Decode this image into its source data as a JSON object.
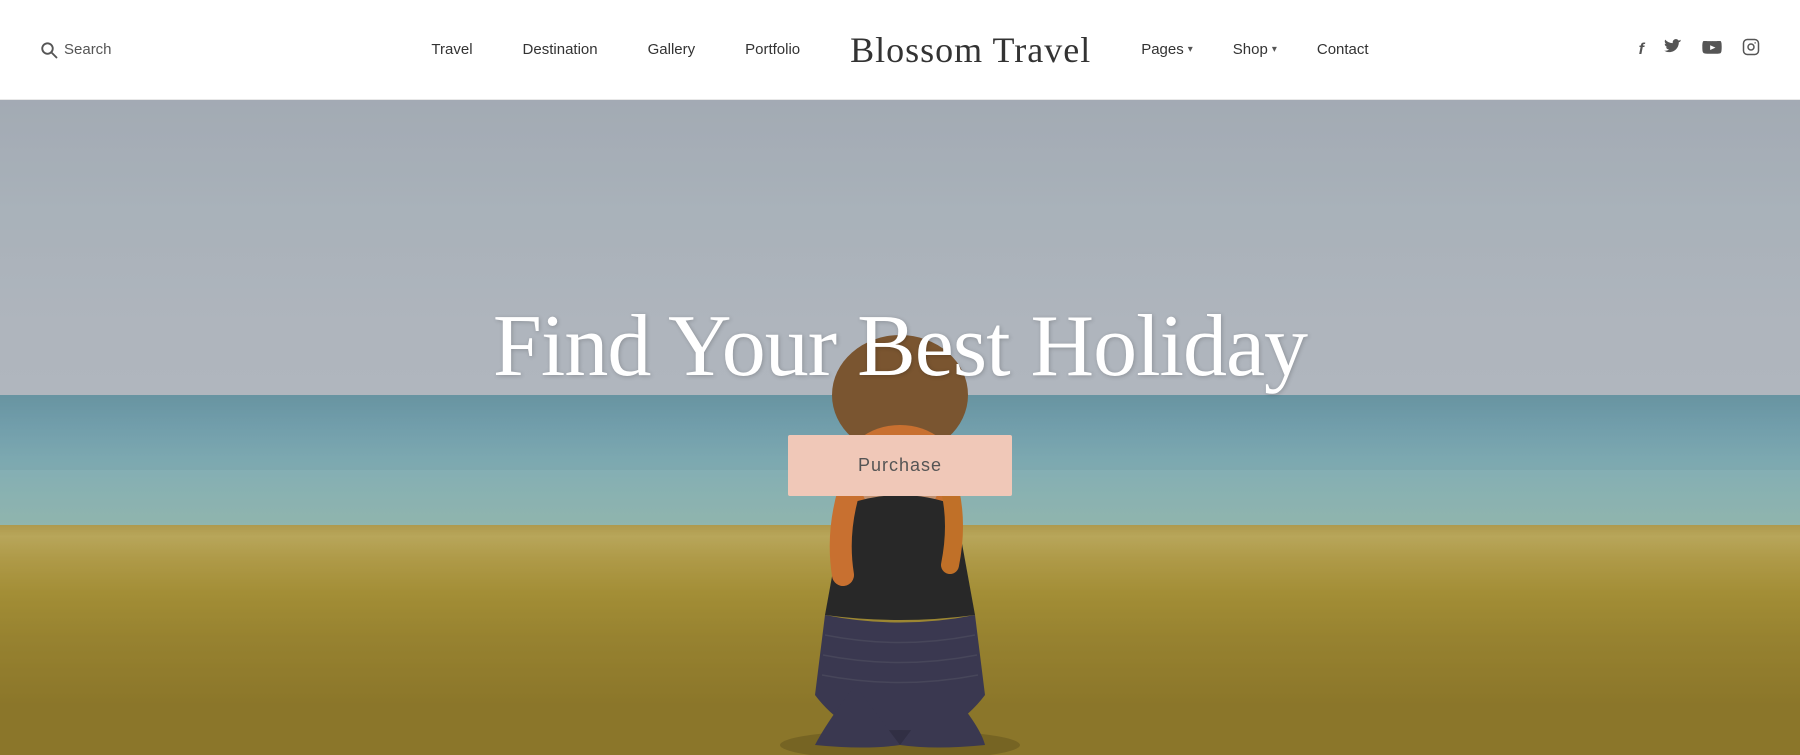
{
  "header": {
    "search_label": "Search",
    "logo": "Blossom Travel",
    "nav_left": [
      {
        "label": "Travel",
        "has_dropdown": false
      },
      {
        "label": "Destination",
        "has_dropdown": false
      },
      {
        "label": "Gallery",
        "has_dropdown": false
      },
      {
        "label": "Portfolio",
        "has_dropdown": false
      }
    ],
    "nav_right": [
      {
        "label": "Pages",
        "has_dropdown": true
      },
      {
        "label": "Shop",
        "has_dropdown": true
      },
      {
        "label": "Contact",
        "has_dropdown": false
      }
    ],
    "social_icons": [
      {
        "name": "facebook-icon",
        "symbol": "f"
      },
      {
        "name": "twitter-icon",
        "symbol": "t"
      },
      {
        "name": "youtube-icon",
        "symbol": "▶"
      },
      {
        "name": "instagram-icon",
        "symbol": "◻"
      }
    ]
  },
  "hero": {
    "title": "Find Your Best Holiday",
    "purchase_button": "Purchase"
  }
}
